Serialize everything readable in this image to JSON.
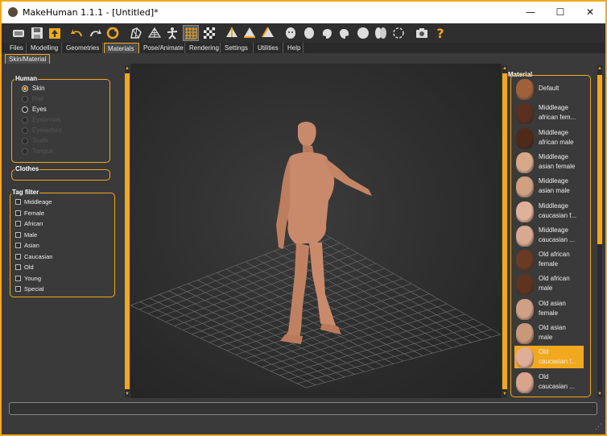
{
  "window": {
    "title": "MakeHuman 1.1.1 - [Untitled]*",
    "minimize": "—",
    "maximize": "☐",
    "close": "✕"
  },
  "toolbar": {
    "icons": [
      "undo-arrow-icon",
      "redo-arrow-icon",
      "reset-icon",
      "save-icon",
      "load-icon",
      "export-icon",
      "smooth-icon",
      "wireframe-icon",
      "pose-icon",
      "grid-icon",
      "checker-icon",
      "front-view-icon",
      "back-view-icon",
      "left-view-icon",
      "right-view-icon",
      "top-view-icon",
      "bottom-view-icon",
      "reset-camera-icon",
      "screenshot-icon",
      "help-icon"
    ]
  },
  "tabs": [
    "Files",
    "Modelling",
    "Geometries",
    "Materials",
    "Pose/Animate",
    "Rendering",
    "Settings",
    "Utilities",
    "Help"
  ],
  "active_tab": "Materials",
  "subtab": "Skin/Material",
  "human": {
    "title": "Human",
    "items": [
      {
        "label": "Skin",
        "selected": true,
        "dim": false
      },
      {
        "label": "Hair",
        "selected": false,
        "dim": true
      },
      {
        "label": "Eyes",
        "selected": false,
        "dim": false
      },
      {
        "label": "Eyebrows",
        "selected": false,
        "dim": true
      },
      {
        "label": "Eyelashes",
        "selected": false,
        "dim": true
      },
      {
        "label": "Teeth",
        "selected": false,
        "dim": true
      },
      {
        "label": "Tongue",
        "selected": false,
        "dim": true
      }
    ]
  },
  "clothes": {
    "title": "Clothes"
  },
  "tagfilter": {
    "title": "Tag filter",
    "items": [
      "Middleage",
      "Female",
      "African",
      "Male",
      "Asian",
      "Caucasian",
      "Old",
      "Young",
      "Special"
    ]
  },
  "material": {
    "title": "Material",
    "items": [
      {
        "line1": "Default",
        "line2": "",
        "skin": "#a0603a"
      },
      {
        "line1": "Middleage",
        "line2": "african fem...",
        "skin": "#5a3020"
      },
      {
        "line1": "Middleage",
        "line2": "african male",
        "skin": "#4e2a1a"
      },
      {
        "line1": "Middleage",
        "line2": "asian female",
        "skin": "#d8a888"
      },
      {
        "line1": "Middleage",
        "line2": "asian male",
        "skin": "#d0a080"
      },
      {
        "line1": "Middleage",
        "line2": "caucasian f...",
        "skin": "#e0b098"
      },
      {
        "line1": "Middleage",
        "line2": "caucasian ...",
        "skin": "#d8a890"
      },
      {
        "line1": "Old african",
        "line2": "female",
        "skin": "#6a3a24"
      },
      {
        "line1": "Old african",
        "line2": "male",
        "skin": "#5e3420"
      },
      {
        "line1": "Old asian",
        "line2": "female",
        "skin": "#cfa084"
      },
      {
        "line1": "Old asian",
        "line2": "male",
        "skin": "#c89878"
      },
      {
        "line1": "Old",
        "line2": "caucasian f...",
        "skin": "#e0ae96",
        "selected": true
      },
      {
        "line1": "Old",
        "line2": "caucasian ...",
        "skin": "#d8a48c"
      }
    ]
  },
  "colors": {
    "accent": "#f2a81d",
    "bg": "#3a3a3a",
    "skin": "#c98a6c"
  }
}
